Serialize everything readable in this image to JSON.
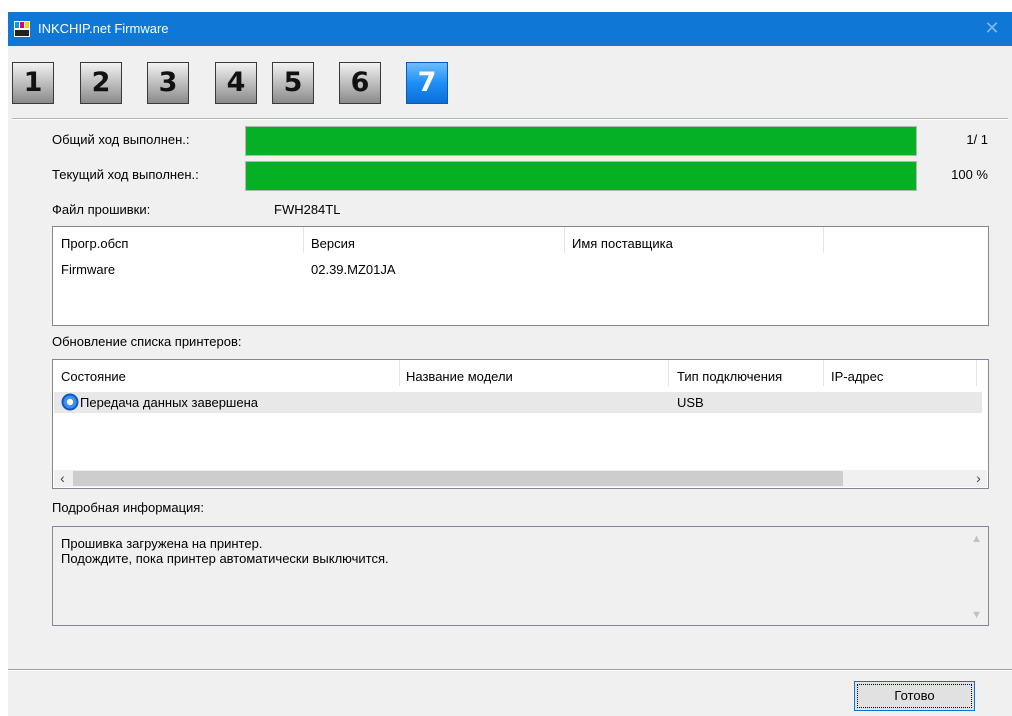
{
  "window": {
    "title": "INKCHIP.net Firmware"
  },
  "steps": [
    "1",
    "2",
    "3",
    "4",
    "5",
    "6",
    "7"
  ],
  "active_step": "7",
  "progress": {
    "overall_label": "Общий ход выполнен.:",
    "overall_value": "1/  1",
    "overall_fraction": 1.0,
    "current_label": "Текущий ход выполнен.:",
    "current_value": "100 %",
    "current_fraction": 1.0
  },
  "firmware_file": {
    "label": "Файл прошивки:",
    "value": "FWH284TL"
  },
  "firmware_table": {
    "headers": [
      "Прогр.обсп",
      "Версия",
      "Имя поставщика"
    ],
    "rows": [
      [
        "Firmware",
        "02.39.MZ01JA",
        ""
      ]
    ]
  },
  "printer_list": {
    "label": "Обновление списка принтеров:",
    "headers": [
      "Состояние",
      "Название модели",
      "Тип подключения",
      "IP-адрес"
    ],
    "rows": [
      {
        "status": "Передача данных завершена",
        "model": "",
        "connection": "USB",
        "ip": ""
      }
    ]
  },
  "details": {
    "label": "Подробная информация:",
    "line1": "Прошивка загружена на принтер.",
    "line2": "Подождите, пока принтер автоматически выключится."
  },
  "buttons": {
    "done": "Готово"
  },
  "colors": {
    "titlebar": "#0f78d7",
    "progress_fill": "#06b025",
    "active_step": "#1f8ff5"
  }
}
